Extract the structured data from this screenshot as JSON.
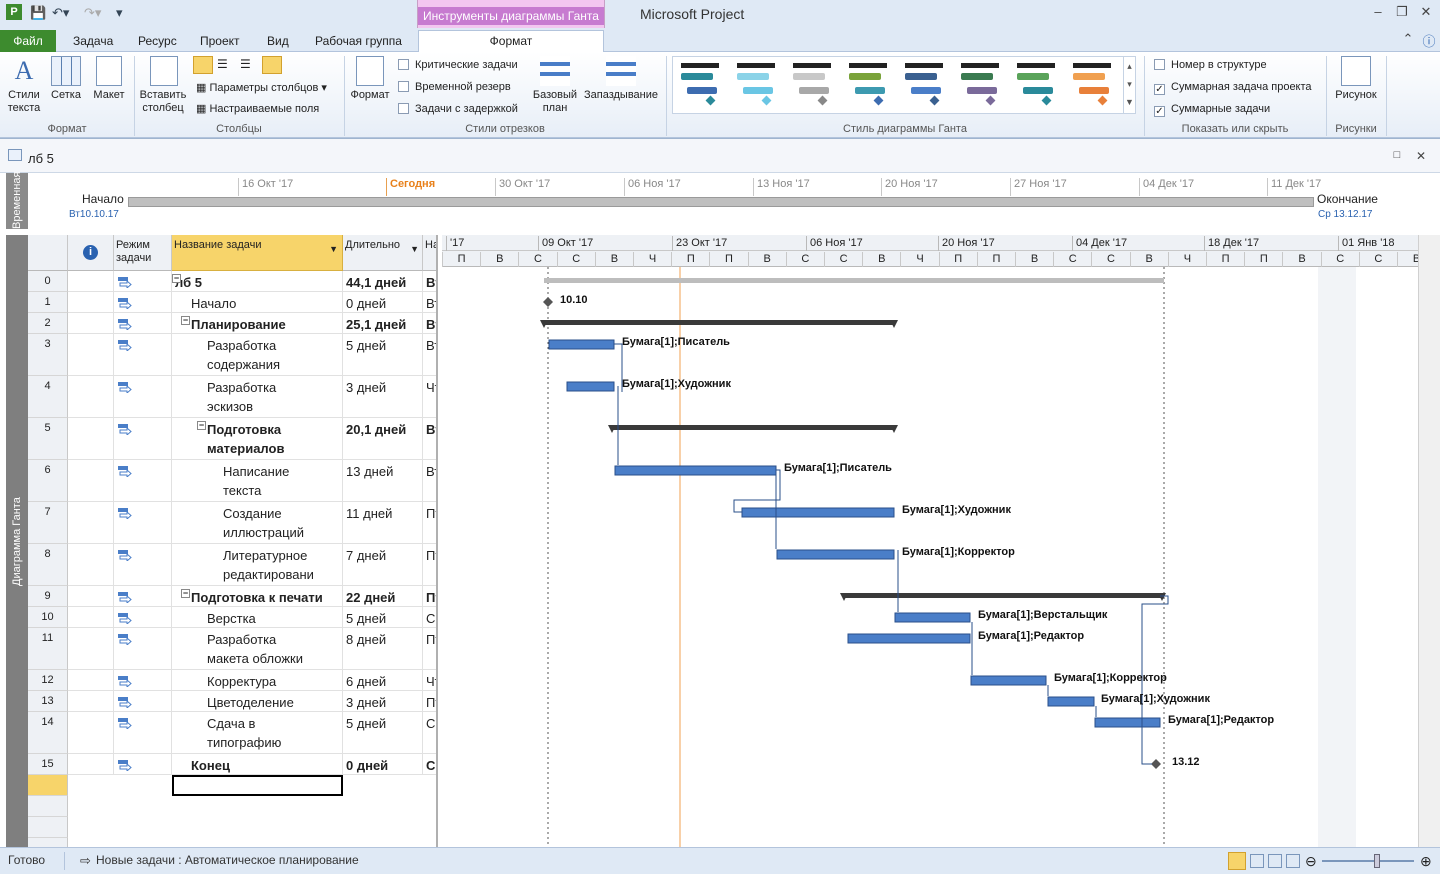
{
  "app": {
    "title": "Microsoft Project",
    "context_tool": "Инструменты диаграммы Ганта"
  },
  "tabs": [
    {
      "label": "Файл"
    },
    {
      "label": "Задача"
    },
    {
      "label": "Ресурс"
    },
    {
      "label": "Проект"
    },
    {
      "label": "Вид"
    },
    {
      "label": "Рабочая группа"
    },
    {
      "label": "Формат"
    }
  ],
  "ribbon": {
    "format_group": {
      "label": "Формат",
      "text_styles": "Стили текста",
      "grid": "Сетка",
      "layout": "Макет"
    },
    "columns_group": {
      "label": "Столбцы",
      "insert_column": "Вставить столбец",
      "column_settings": "Параметры столбцов",
      "custom_fields": "Настраиваемые поля"
    },
    "bar_styles_group": {
      "label": "Стили отрезков",
      "format": "Формат",
      "critical": "Критические задачи",
      "slack": "Временной резерв",
      "late": "Задачи с задержкой",
      "baseline": "Базовый план",
      "delay": "Запаздывание"
    },
    "gantt_style_group": {
      "label": "Стиль диаграммы Ганта"
    },
    "show_hide_group": {
      "label": "Показать или скрыть",
      "outline_number": "Номер в структуре",
      "project_summary": "Суммарная задача проекта",
      "summary_tasks": "Суммарные задачи"
    },
    "drawings_group": {
      "label": "Рисунки",
      "drawing": "Рисунок"
    }
  },
  "document": {
    "title": "лб 5"
  },
  "timeline": {
    "side_label": "Временная",
    "start_label": "Начало",
    "start_date": "Вт10.10.17",
    "end_label": "Окончание",
    "end_date": "Ср 13.12.17",
    "today": "Сегодня",
    "ticks": [
      "16 Окт '17",
      "30 Окт '17",
      "06 Ноя '17",
      "13 Ноя '17",
      "20 Ноя '17",
      "27 Ноя '17",
      "04 Дек '17",
      "11 Дек '17"
    ]
  },
  "gantt_side_label": "Диаграмма Ганта",
  "grid": {
    "headers": {
      "info": "i",
      "mode": "Режим задачи",
      "name": "Название задачи",
      "duration": "Длительно",
      "start": "На"
    },
    "rows": [
      {
        "id": "0",
        "name": "лб 5",
        "duration": "44,1 дней",
        "start": "Вт",
        "bold": true,
        "indent": 0,
        "collapsible": true
      },
      {
        "id": "1",
        "name": "Начало",
        "duration": "0 дней",
        "start": "Вт",
        "bold": false,
        "indent": 1
      },
      {
        "id": "2",
        "name": "Планирование",
        "duration": "25,1 дней",
        "start": "Вт",
        "bold": true,
        "indent": 1,
        "collapsible": true
      },
      {
        "id": "3",
        "name": "Разработка",
        "name2": "содержания",
        "duration": "5 дней",
        "start": "Вт",
        "bold": false,
        "indent": 2
      },
      {
        "id": "4",
        "name": "Разработка",
        "name2": "эскизов",
        "duration": "3 дней",
        "start": "Чт",
        "bold": false,
        "indent": 2
      },
      {
        "id": "5",
        "name": "Подготовка",
        "name2": "материалов",
        "duration": "20,1 дней",
        "start": "Вт",
        "bold": true,
        "indent": 2,
        "collapsible": true
      },
      {
        "id": "6",
        "name": "Написание",
        "name2": "текста",
        "duration": "13 дней",
        "start": "Вт",
        "bold": false,
        "indent": 3
      },
      {
        "id": "7",
        "name": "Создание",
        "name2": "иллюстраций",
        "duration": "11 дней",
        "start": "Пт",
        "bold": false,
        "indent": 3
      },
      {
        "id": "8",
        "name": "Литературное",
        "name2": "редактировани",
        "duration": "7 дней",
        "start": "Пт",
        "bold": false,
        "indent": 3
      },
      {
        "id": "9",
        "name": "Подготовка к печати",
        "duration": "22 дней",
        "start": "Пт",
        "bold": true,
        "indent": 1,
        "collapsible": true
      },
      {
        "id": "10",
        "name": "Верстка",
        "duration": "5 дней",
        "start": "Ср",
        "bold": false,
        "indent": 2
      },
      {
        "id": "11",
        "name": "Разработка",
        "name2": "макета обложки",
        "duration": "8 дней",
        "start": "Пт",
        "bold": false,
        "indent": 2
      },
      {
        "id": "12",
        "name": "Корректура",
        "duration": "6 дней",
        "start": "Чт",
        "bold": false,
        "indent": 2
      },
      {
        "id": "13",
        "name": "Цветоделение",
        "duration": "3 дней",
        "start": "Пт",
        "bold": false,
        "indent": 2
      },
      {
        "id": "14",
        "name": "Сдача в",
        "name2": "типографию",
        "duration": "5 дней",
        "start": "Ср",
        "bold": false,
        "indent": 2
      },
      {
        "id": "15",
        "name": "Конец",
        "duration": "0 дней",
        "start": "Ср",
        "bold": true,
        "indent": 1
      }
    ]
  },
  "chart": {
    "weeks": [
      "'17",
      "09 Окт '17",
      "23 Окт '17",
      "06 Ноя '17",
      "20 Ноя '17",
      "04 Дек '17",
      "18 Дек '17",
      "01 Янв '18"
    ],
    "days": [
      "П",
      "В",
      "С",
      "С",
      "В",
      "Ч",
      "П",
      "П",
      "В",
      "С",
      "С",
      "В",
      "Ч",
      "П",
      "П",
      "В",
      "С",
      "С",
      "В",
      "Ч",
      "П",
      "П",
      "В",
      "С",
      "С",
      "В"
    ],
    "labels": {
      "m1": "10.10",
      "r3": "Бумага[1];Писатель",
      "r4": "Бумага[1];Художник",
      "r6": "Бумага[1];Писатель",
      "r7": "Бумага[1];Художник",
      "r8": "Бумага[1];Корректор",
      "r10": "Бумага[1];Верстальщик",
      "r11": "Бумага[1];Редактор",
      "r12": "Бумага[1];Корректор",
      "r13": "Бумага[1];Художник",
      "r14": "Бумага[1];Редактор",
      "m15": "13.12"
    },
    "colors": {
      "task": "#4a7ec8",
      "summary": "#3a3a3a",
      "today": "#f0a050"
    }
  },
  "status": {
    "ready": "Готово",
    "new_tasks": "Новые задачи : Автоматическое планирование"
  }
}
